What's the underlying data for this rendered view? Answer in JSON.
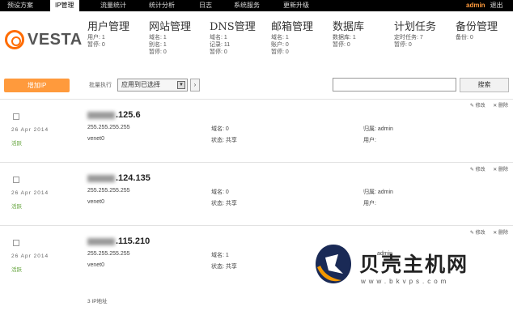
{
  "nav": {
    "items": [
      "预设方案",
      "IP管理",
      "流量统计",
      "统计分析",
      "日志",
      "系统服务",
      "更新升级"
    ],
    "user": "admin",
    "logout": "退出"
  },
  "logo": "VESTA",
  "stats": [
    {
      "title": "用户管理",
      "lines": [
        "用户: 1",
        "暂停: 0"
      ]
    },
    {
      "title": "网站管理",
      "lines": [
        "域名: 1",
        "别名: 1",
        "暂停: 0"
      ]
    },
    {
      "title": "DNS管理",
      "lines": [
        "域名: 1",
        "记录: 11",
        "暂停: 0"
      ]
    },
    {
      "title": "邮箱管理",
      "lines": [
        "域名: 1",
        "账户: 0",
        "暂停: 0"
      ]
    },
    {
      "title": "数据库",
      "lines": [
        "数据库: 1",
        "暂停: 0"
      ]
    },
    {
      "title": "计划任务",
      "lines": [
        "定时任务: 7",
        "暂停: 0"
      ]
    },
    {
      "title": "备份管理",
      "lines": [
        "备份: 0"
      ]
    }
  ],
  "toolbar": {
    "add_label": "增加IP",
    "bulk_label": "批量执行",
    "bulk_value": "应用到已选择",
    "apply_symbol": "›",
    "search_placeholder": "",
    "search_label": "搜索"
  },
  "row_actions": {
    "edit": "修改",
    "delete": "删除"
  },
  "rows": [
    {
      "date": "26 Apr 2014",
      "status": "活跃",
      "ip_visible": ".125.6",
      "netmask": "255.255.255.255",
      "iface": "venet0",
      "domains": "域名: 0",
      "state": "状态: 共享",
      "owner": "归属: admin",
      "users": "用户:"
    },
    {
      "date": "26 Apr 2014",
      "status": "活跃",
      "ip_visible": ".124.135",
      "netmask": "255.255.255.255",
      "iface": "venet0",
      "domains": "域名: 0",
      "state": "状态: 共享",
      "owner": "归属: admin",
      "users": "用户:"
    },
    {
      "date": "26 Apr 2014",
      "status": "活跃",
      "ip_visible": ".115.210",
      "netmask": "255.255.255.255",
      "iface": "venet0",
      "domains": "域名: 1",
      "state": "状态: 共享",
      "owner": "admin",
      "users": ""
    }
  ],
  "footer": "3 IP地址",
  "watermark": {
    "text": "贝壳主机网",
    "url": "www.bkvps.com"
  }
}
